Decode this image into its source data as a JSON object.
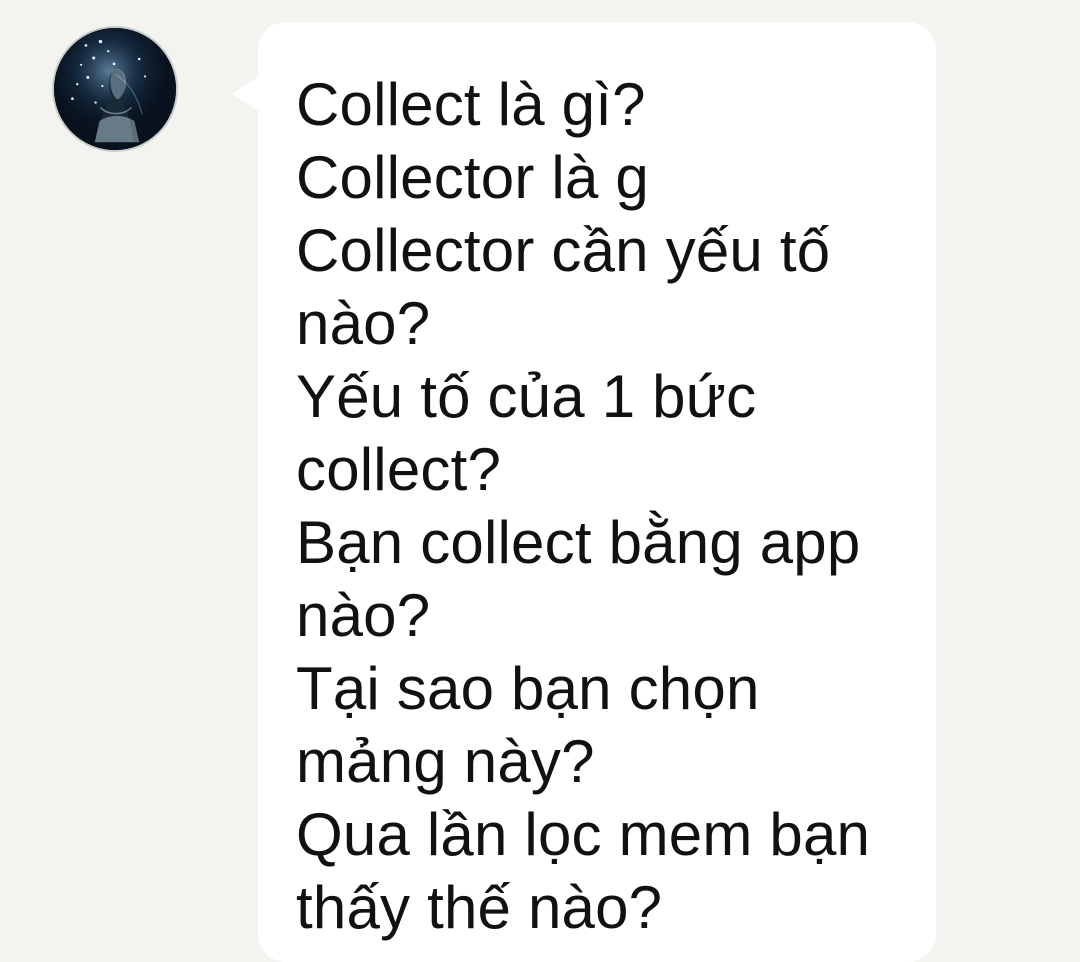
{
  "conversation": {
    "avatar_icon": "profile-avatar-starry-night",
    "message": {
      "lines": [
        "Collect là gì?",
        "Collector là g",
        "Collector cần yếu tố",
        "nào?",
        "Yếu tố của 1 bức",
        "collect?",
        "Bạn collect bằng app",
        "nào?",
        "Tại sao bạn chọn",
        "mảng này?",
        "Qua lần lọc mem bạn",
        "thấy thế nào?"
      ]
    }
  },
  "colors": {
    "background": "#f3f4ef",
    "bubble": "#ffffff",
    "text": "#111111"
  }
}
